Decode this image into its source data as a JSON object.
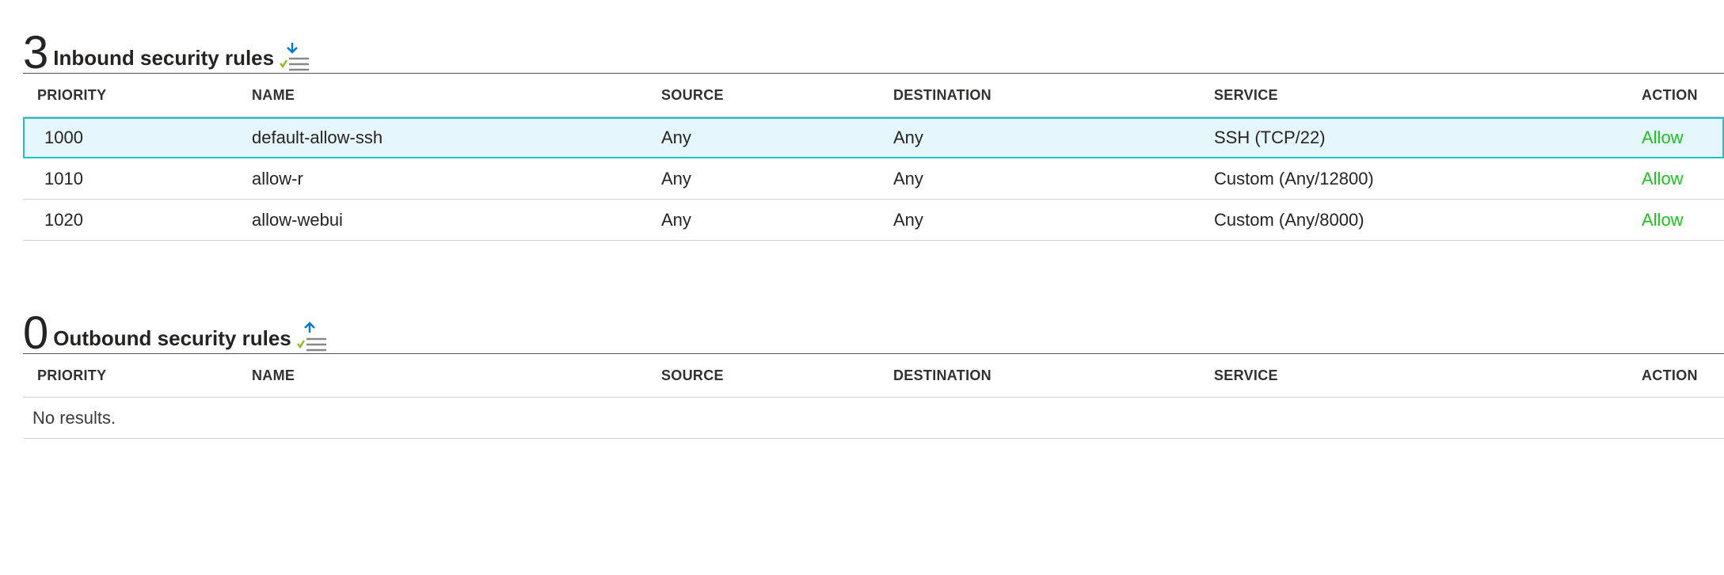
{
  "inbound": {
    "count": "3",
    "title": "Inbound security rules",
    "icon": "sort-down-icon",
    "columns": [
      "PRIORITY",
      "NAME",
      "SOURCE",
      "DESTINATION",
      "SERVICE",
      "ACTION"
    ],
    "rows": [
      {
        "priority": "1000",
        "name": "default-allow-ssh",
        "source": "Any",
        "destination": "Any",
        "service": "SSH (TCP/22)",
        "action": "Allow"
      },
      {
        "priority": "1010",
        "name": "allow-r",
        "source": "Any",
        "destination": "Any",
        "service": "Custom (Any/12800)",
        "action": "Allow"
      },
      {
        "priority": "1020",
        "name": "allow-webui",
        "source": "Any",
        "destination": "Any",
        "service": "Custom (Any/8000)",
        "action": "Allow"
      }
    ]
  },
  "outbound": {
    "count": "0",
    "title": "Outbound security rules",
    "icon": "sort-up-icon",
    "columns": [
      "PRIORITY",
      "NAME",
      "SOURCE",
      "DESTINATION",
      "SERVICE",
      "ACTION"
    ],
    "empty_text": "No results."
  },
  "colors": {
    "allow": "#1ec41e",
    "selected_bg": "#e6f6fd",
    "selected_border": "#21bfcc",
    "icon_arrow": "#0078d4",
    "icon_check": "#8cbd18"
  }
}
